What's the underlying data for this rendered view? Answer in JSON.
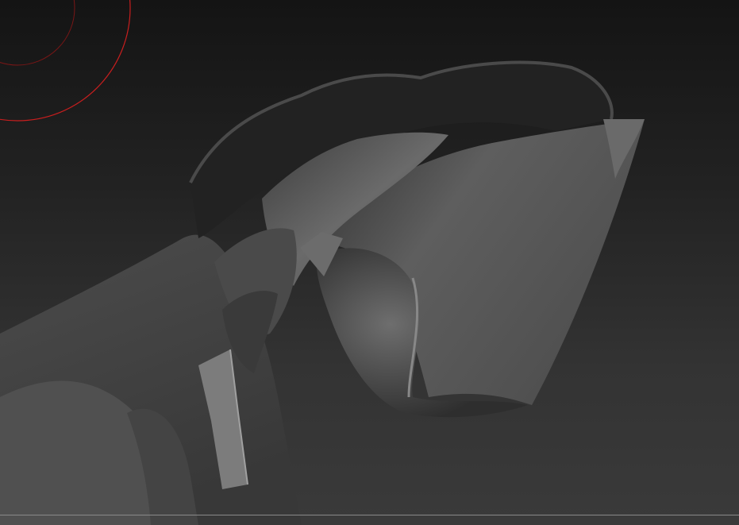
{
  "viewport": {
    "background_top": "#141414",
    "background_bottom": "#3a3a3a",
    "model_color": "#5a5a5a"
  },
  "brush": {
    "icon": "brush-cursor-icon",
    "ring_color": "#c81e1e"
  }
}
